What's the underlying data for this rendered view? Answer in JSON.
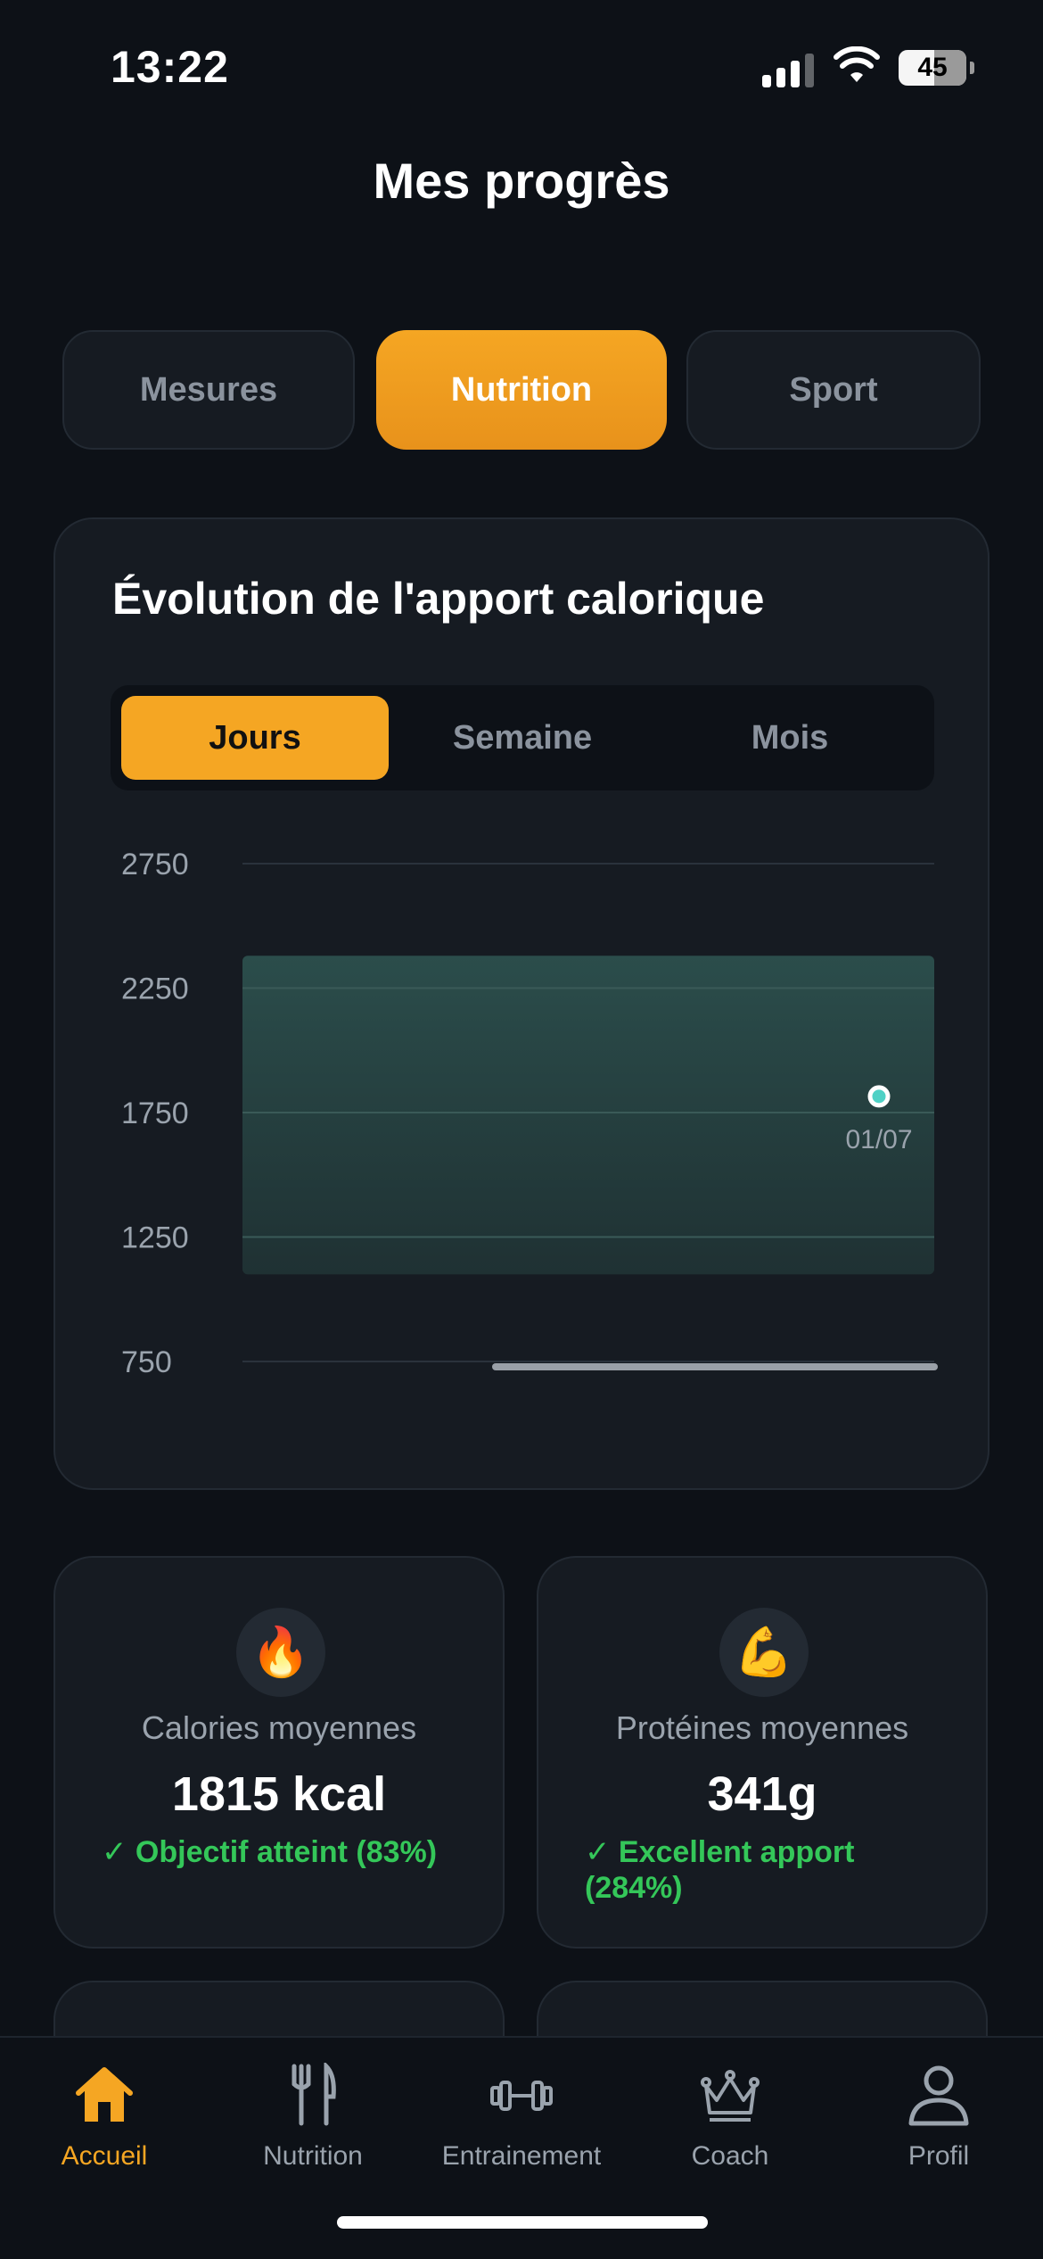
{
  "status_bar": {
    "time": "13:22",
    "battery": "45"
  },
  "page": {
    "title": "Mes progrès"
  },
  "tabs": [
    {
      "label": "Mesures",
      "active": false
    },
    {
      "label": "Nutrition",
      "active": true
    },
    {
      "label": "Sport",
      "active": false
    }
  ],
  "chart_card": {
    "title": "Évolution de l'apport calorique",
    "periods": [
      {
        "label": "Jours",
        "active": true
      },
      {
        "label": "Semaine",
        "active": false
      },
      {
        "label": "Mois",
        "active": false
      }
    ]
  },
  "chart_data": {
    "type": "line",
    "title": "Évolution de l'apport calorique",
    "xlabel": "",
    "ylabel": "",
    "ylim": [
      750,
      2750
    ],
    "y_ticks": [
      "2750",
      "2250",
      "1750",
      "1250",
      "750"
    ],
    "target_band": [
      1100,
      2380
    ],
    "points": [
      {
        "x": "01/07",
        "y": 1815
      }
    ],
    "grid": true,
    "colors": {
      "band": "#2a4b4a",
      "point": "#4fd1c5",
      "grid": "#2a323c"
    }
  },
  "stats": [
    {
      "icon": "🔥",
      "icon_name": "fire-icon",
      "label": "Calories moyennes",
      "value": "1815 kcal",
      "note": "✓ Objectif atteint (83%)"
    },
    {
      "icon": "💪",
      "icon_name": "flexed-biceps-icon",
      "label": "Protéines moyennes",
      "value": "341g",
      "note": "✓ Excellent apport (284%)"
    }
  ],
  "bottom_nav": [
    {
      "label": "Accueil",
      "icon": "home-icon",
      "active": true
    },
    {
      "label": "Nutrition",
      "icon": "fork-knife-icon",
      "active": false
    },
    {
      "label": "Entrainement",
      "icon": "dumbbell-icon",
      "active": false
    },
    {
      "label": "Coach",
      "icon": "crown-icon",
      "active": false
    },
    {
      "label": "Profil",
      "icon": "person-icon",
      "active": false
    }
  ],
  "colors": {
    "accent": "#f5a623",
    "background": "#0d1117",
    "card": "#161b22",
    "success": "#34c759"
  }
}
